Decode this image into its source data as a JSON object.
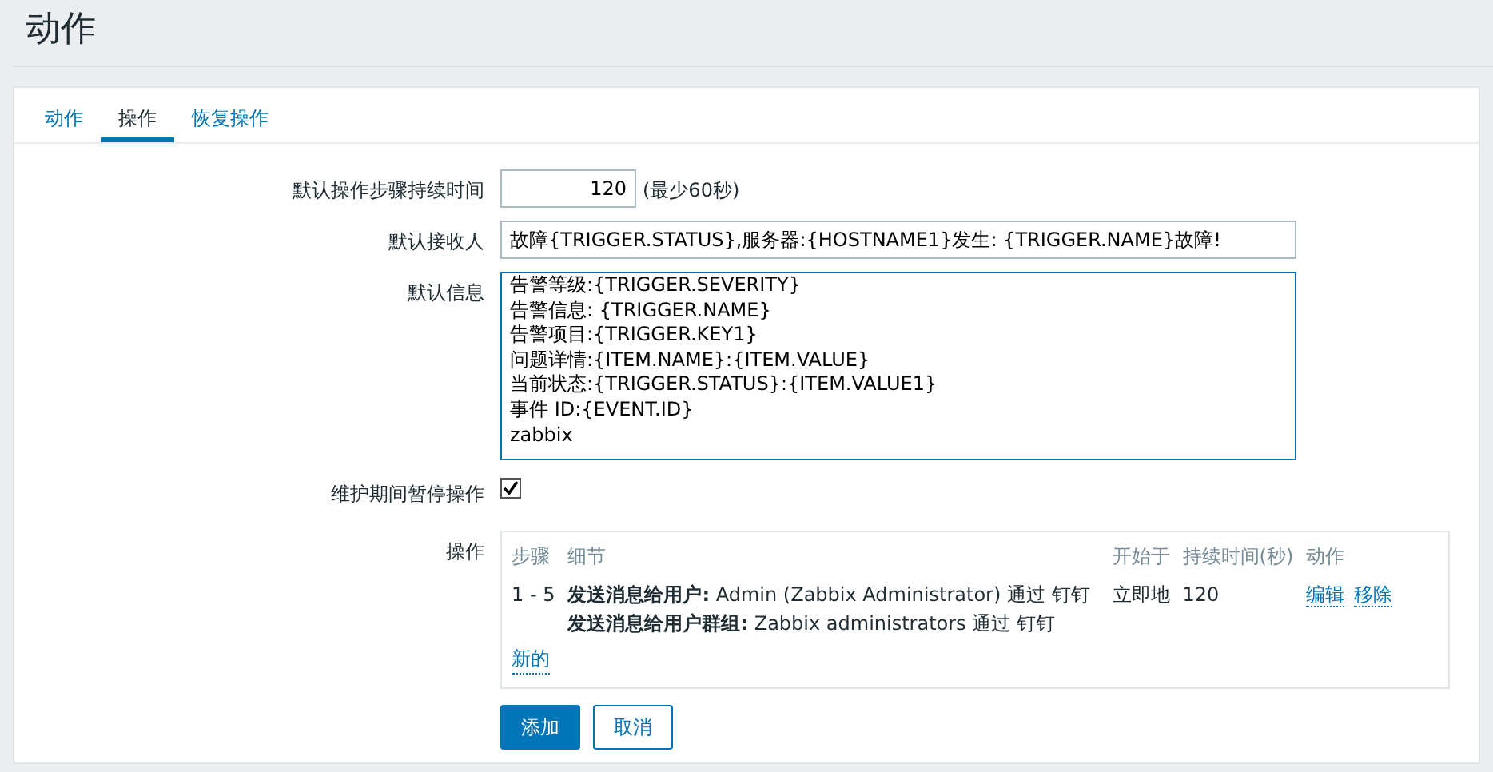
{
  "page_title": "动作",
  "tabs": [
    {
      "label": "动作",
      "selected": false
    },
    {
      "label": "操作",
      "selected": true
    },
    {
      "label": "恢复操作",
      "selected": false
    }
  ],
  "form": {
    "step_duration": {
      "label": "默认操作步骤持续时间",
      "value": "120",
      "hint": "(最少60秒)"
    },
    "subject": {
      "label": "默认接收人",
      "value": "故障{TRIGGER.STATUS},服务器:{HOSTNAME1}发生: {TRIGGER.NAME}故障!"
    },
    "message": {
      "label": "默认信息",
      "lines": [
        "告警等级:{TRIGGER.SEVERITY}",
        "告警信息: {TRIGGER.NAME}",
        "告警项目:{TRIGGER.KEY1}",
        "问题详情:{ITEM.NAME}:{ITEM.VALUE}",
        "当前状态:{TRIGGER.STATUS}:{ITEM.VALUE1}",
        "事件 ID:{EVENT.ID}",
        "zabbix"
      ]
    },
    "pause_in_maintenance": {
      "label": "维护期间暂停操作",
      "checked": true
    },
    "operations": {
      "label": "操作",
      "columns": [
        "步骤",
        "细节",
        "开始于",
        "持续时间(秒)",
        "动作"
      ],
      "rows": [
        {
          "steps": "1 - 5",
          "details": [
            "**发送消息给用户:** Admin (Zabbix Administrator) 通过 钉钉",
            "**发送消息给用户群组:** Zabbix administrators 通过 钉钉"
          ],
          "start_in": "立即地",
          "duration": "120",
          "actions": [
            "编辑",
            "移除"
          ]
        }
      ],
      "new_link": "新的"
    }
  },
  "buttons": [
    {
      "label": "添加",
      "kind": "primary"
    },
    {
      "label": "取消",
      "kind": "secondary"
    }
  ]
}
